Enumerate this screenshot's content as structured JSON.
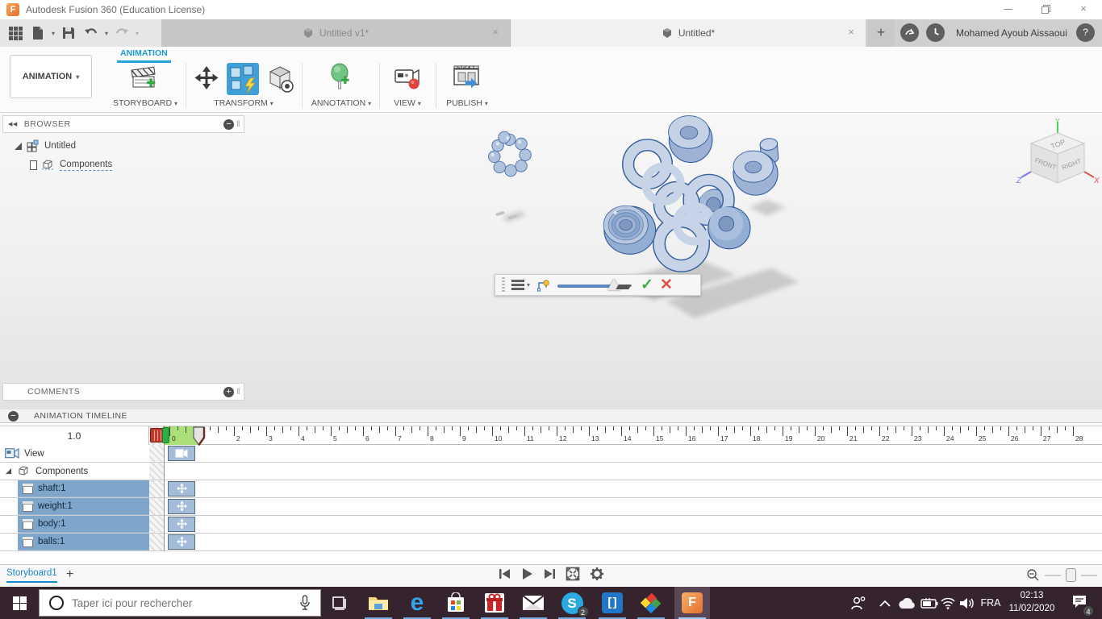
{
  "window": {
    "title": "Autodesk Fusion 360 (Education License)"
  },
  "glyphs": {
    "caret": "▾",
    "close": "×",
    "plus": "+",
    "minus": "−",
    "question": "?",
    "collapse": "◀◀",
    "grip": "‖",
    "check": "✓",
    "cross": "✕"
  },
  "document_tabs": {
    "inactive": "Untitled v1*",
    "active": "Untitled*",
    "user_name": "Mohamed Ayoub Aissaoui"
  },
  "ribbon": {
    "workspace_selector": "ANIMATION",
    "active_tab": "ANIMATION",
    "groups": [
      {
        "label": "STORYBOARD"
      },
      {
        "label": "TRANSFORM"
      },
      {
        "label": "ANNOTATION"
      },
      {
        "label": "VIEW"
      },
      {
        "label": "PUBLISH"
      }
    ]
  },
  "browser_panel": {
    "title": "BROWSER",
    "root_item": "Untitled",
    "child_item": "Components"
  },
  "comments_panel": {
    "title": "COMMENTS"
  },
  "viewcube": {
    "top": "TOP",
    "front": "FRONT",
    "right": "RIGHT",
    "axis_x": "X",
    "axis_y": "Y",
    "axis_z": "Z"
  },
  "canvas_toolbar_icons": [
    "orbit",
    "look-at",
    "pan",
    "zoom",
    "fit",
    "display-settings",
    "grid-settings"
  ],
  "explode_toolbar": {
    "icons": [
      "drag-handle",
      "explode-type-list",
      "trail-lines",
      "distance-slider",
      "ok",
      "cancel"
    ],
    "slider_fraction": 0.78
  },
  "animation_timeline": {
    "title": "ANIMATION TIMELINE",
    "current_time": "1.0",
    "ruler": {
      "start": 0,
      "end": 28,
      "units_per_40px": 1,
      "numbers": [
        0,
        2,
        3,
        4,
        5,
        6,
        7,
        8,
        9,
        10,
        11,
        12,
        13,
        14,
        15,
        16,
        17,
        18,
        19,
        20,
        21,
        22,
        23,
        24,
        25,
        26,
        27,
        28
      ]
    },
    "playhead_time": 1.0,
    "rows": [
      {
        "label": "View",
        "icon": "camera",
        "selected": false,
        "block": "camera"
      },
      {
        "label": "Components",
        "icon": "component",
        "selected": false,
        "block": null
      },
      {
        "label": "shaft:1",
        "icon": "cube",
        "selected": true,
        "block": "move"
      },
      {
        "label": "weight:1",
        "icon": "cube",
        "selected": true,
        "block": "move"
      },
      {
        "label": "body:1",
        "icon": "cube",
        "selected": true,
        "block": "move"
      },
      {
        "label": "balls:1",
        "icon": "cube",
        "selected": true,
        "block": "move"
      }
    ],
    "storyboard_tab": "Storyboard1"
  },
  "taskbar": {
    "search_placeholder": "Taper ici pour rechercher",
    "apps": [
      "file-explorer",
      "edge",
      "microsoft-store",
      "gift-app",
      "mail",
      "skype",
      "brackets",
      "color-diamond-app",
      "fusion-360"
    ],
    "skype_badge": "2",
    "language": "FRA",
    "time": "02:13",
    "date": "11/02/2020",
    "notifications_badge": "4"
  },
  "colors": {
    "fusion_accent": "#0696d7",
    "selection_blue": "#7da6ca",
    "timeline_green": "#abdf77",
    "taskbar_bg": "#35232e",
    "model_light": "#c7d4e7",
    "model_dark_edge": "#35619c"
  }
}
